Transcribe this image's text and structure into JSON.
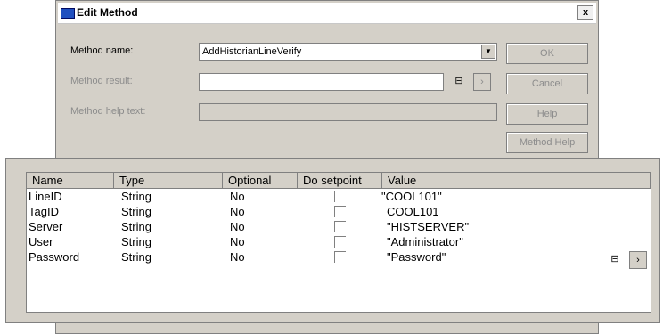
{
  "dialog": {
    "title": "Edit Method",
    "close_label": "x",
    "method_name_label": "Method name:",
    "method_name_value": "AddHistorianLineVerify",
    "method_result_label": "Method result:",
    "method_result_value": "",
    "method_help_label": "Method help text:",
    "method_help_value": "",
    "buttons": {
      "ok": "OK",
      "cancel": "Cancel",
      "help": "Help",
      "method_help": "Method Help"
    }
  },
  "params": {
    "headers": [
      "Name",
      "Type",
      "Optional",
      "Do setpoint",
      "Value"
    ],
    "rows": [
      {
        "name": "LineID",
        "type": "String",
        "optional": "No",
        "value": "\"COOL101\""
      },
      {
        "name": "TagID",
        "type": "String",
        "optional": "No",
        "value": "COOL101"
      },
      {
        "name": "Server",
        "type": "String",
        "optional": "No",
        "value": "\"HISTSERVER\""
      },
      {
        "name": "User",
        "type": "String",
        "optional": "No",
        "value": "\"Administrator\""
      },
      {
        "name": "Password",
        "type": "String",
        "optional": "No",
        "value": "\"Password\""
      }
    ]
  },
  "colors": {
    "dialog_bg": "#d4d0c8",
    "title_icon": "#1f4fbf"
  }
}
